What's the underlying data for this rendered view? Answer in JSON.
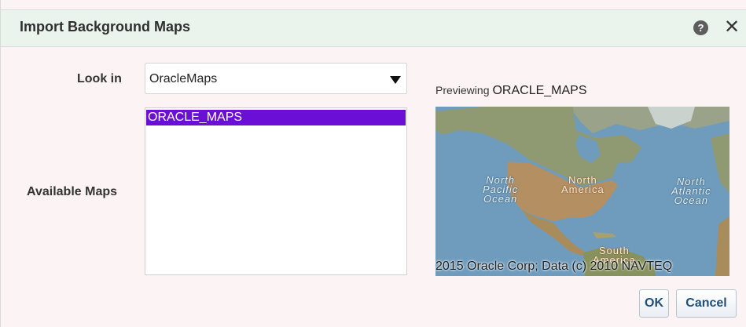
{
  "dialog": {
    "title": "Import Background Maps",
    "help_icon": "question-circle-icon",
    "close_icon": "close-icon",
    "help_glyph": "?",
    "close_glyph": "✕"
  },
  "form": {
    "look_in_label": "Look in",
    "look_in_value": "OracleMaps",
    "available_maps_label": "Available Maps",
    "available_maps": [
      "ORACLE_MAPS"
    ],
    "selected_map": "ORACLE_MAPS"
  },
  "preview": {
    "label": "Previewing",
    "name": "ORACLE_MAPS",
    "map_labels": {
      "north_pacific": "North\nPacific\nOcean",
      "north_america": "North\nAmerica",
      "north_atlantic": "North\nAtlantic\nOcean",
      "south_america": "South\nAmerica"
    },
    "attribution": "2015 Oracle Corp; Data (c) 2010 NAVTEQ"
  },
  "buttons": {
    "ok": "OK",
    "cancel": "Cancel"
  },
  "colors": {
    "selection": "#6b0fd6",
    "button_text": "#1f4e79",
    "titlebar": "#eaf3ec"
  }
}
